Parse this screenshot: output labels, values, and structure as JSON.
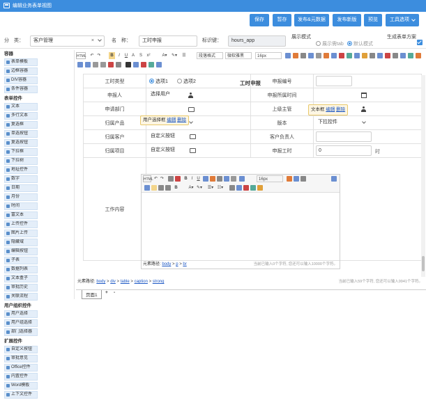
{
  "window": {
    "title": "编辑业务表单视图"
  },
  "toolbar": {
    "save": "保存",
    "draft": "暂存",
    "publish_data": "发布&元数据",
    "publish_new": "发布新版",
    "preview": "预览",
    "tools": "工具选项"
  },
  "form": {
    "category_label": "分　类：",
    "category_value": "客户管理",
    "name_label": "名　称：",
    "name_value": "工时申报",
    "id_label": "标识键：",
    "id_value": "hours_app",
    "display_mode_label": "展示模式",
    "mode_tab": "展示需tab",
    "mode_default": "默认模式",
    "gen_table_label": "生成表单方案"
  },
  "sidebar": {
    "sections": [
      {
        "title": "容器",
        "items": [
          "表单模板",
          "边框容器",
          "DIV容器",
          "条件容器"
        ]
      },
      {
        "title": "表单控件",
        "items": [
          "文本",
          "多行文本",
          "复选框",
          "单选按钮",
          "复选按钮",
          "下拉框",
          "下拉树",
          "地址控件",
          "数字",
          "日期",
          "月份",
          "时间",
          "富文本",
          "上传控件",
          "图片上传",
          "隐藏域",
          "编辑按钮",
          "子表",
          "数据列表",
          "文本盒子",
          "审批历史",
          "关联流程"
        ]
      },
      {
        "title": "用户组织控件",
        "items": [
          "用户选择",
          "用户组选择",
          "部门选择器"
        ]
      },
      {
        "title": "扩展控件",
        "items": [
          "自定义按钮",
          "审批意见",
          "Office控件",
          "内置控件",
          "Word模板",
          "上下文控件"
        ]
      }
    ]
  },
  "editor_toolbar": {
    "html": "HTML",
    "paragraph": "段落格式",
    "font": "微软雅黑",
    "size": "16px"
  },
  "doc": {
    "title": "工时申报",
    "rows": [
      {
        "l1": "工时类型",
        "opt1": "选项1",
        "opt2": "选项2",
        "l2": "申报编号",
        "v2": ""
      },
      {
        "l1": "申报人",
        "v1": "选择用户",
        "l2": "申报所属时间",
        "v2": ""
      },
      {
        "l1": "申请部门",
        "v1": "",
        "l2": "上级主管",
        "v2": "选择用户"
      },
      {
        "l1": "归属产品",
        "v1": "下拉控件",
        "l2": "版本",
        "v2": "下拉控件"
      },
      {
        "l1": "归属客户",
        "v1": "自定义按钮",
        "l2": "客户负责人",
        "v2": ""
      },
      {
        "l1": "归属项目",
        "v1": "自定义按钮",
        "l2": "申报工时",
        "v2": "0",
        "unit": "时"
      },
      {
        "l1": "工作内容"
      }
    ],
    "popup_user": {
      "text": "用户选择框",
      "edit": "编辑",
      "del": "删除"
    },
    "popup_text": {
      "text": "文本框",
      "edit": "编辑",
      "del": "删除"
    },
    "sub_path_label": "元素路径:",
    "sub_path": [
      "body",
      "p",
      "br"
    ],
    "sub_count": "当前已输入0个字符, 您还可以输入10000个字符。",
    "sub_size": "16px"
  },
  "status": {
    "path_label": "元素路径:",
    "path": [
      "body",
      "div",
      "table",
      "caption",
      "strong"
    ],
    "count": "当前已输入59个字符, 您还可以输入9941个字符。"
  },
  "pages": {
    "tab": "页面1",
    "add": "+",
    "remove": "-"
  }
}
